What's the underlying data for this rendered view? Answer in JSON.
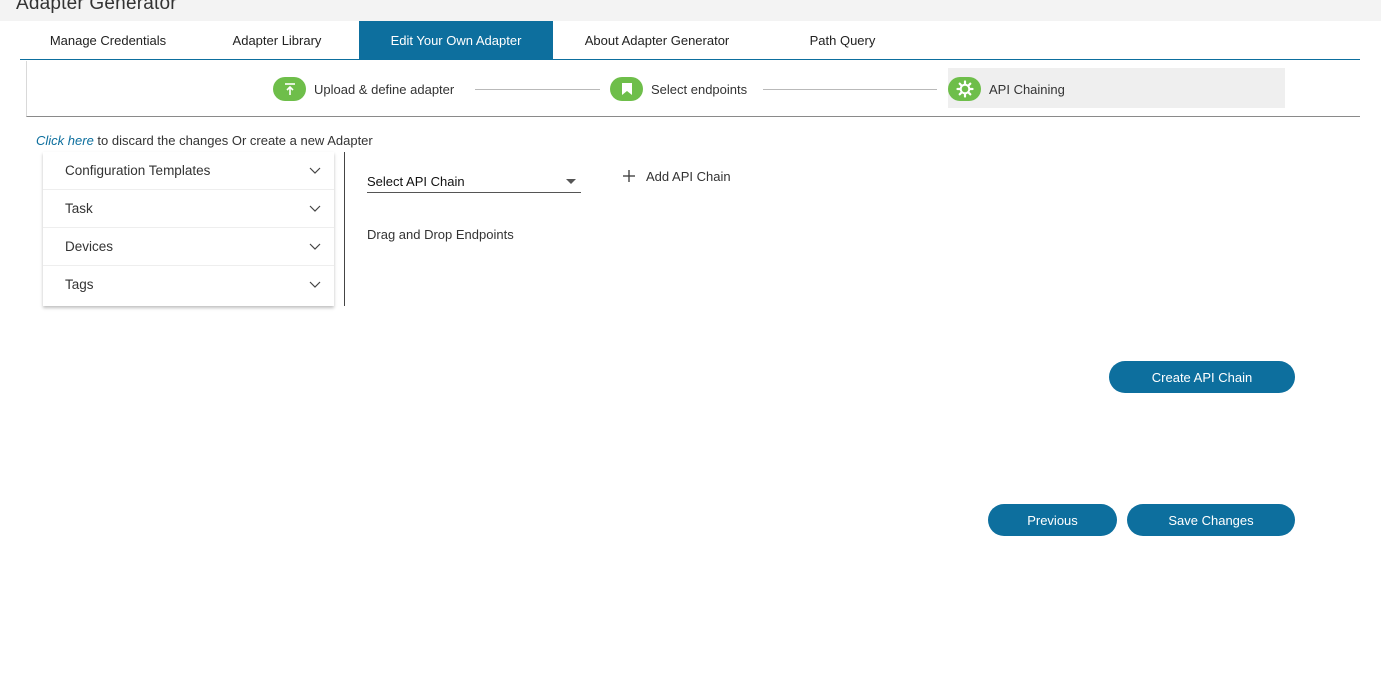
{
  "app": {
    "title": "Adapter Generator"
  },
  "tabs": [
    {
      "label": "Manage Credentials"
    },
    {
      "label": "Adapter Library"
    },
    {
      "label": "Edit Your Own Adapter",
      "active": true
    },
    {
      "label": "About Adapter Generator"
    },
    {
      "label": "Path Query"
    }
  ],
  "stepper": {
    "steps": [
      {
        "label": "Upload & define adapter",
        "icon": "upload-icon"
      },
      {
        "label": "Select endpoints",
        "icon": "bookmark-icon"
      },
      {
        "label": "API Chaining",
        "icon": "gear-icon",
        "active": true
      }
    ]
  },
  "discard": {
    "link_text": "Click here",
    "rest_text": " to discard the changes Or create a new Adapter"
  },
  "accordion": {
    "items": [
      {
        "label": "Configuration Templates"
      },
      {
        "label": "Task"
      },
      {
        "label": "Devices"
      },
      {
        "label": "Tags"
      }
    ]
  },
  "chain": {
    "select_value": "Select API Chain",
    "add_label": "Add API Chain",
    "dnd_text": "Drag and Drop Endpoints",
    "create_label": "Create API Chain"
  },
  "footer": {
    "previous_label": "Previous",
    "save_label": "Save Changes"
  },
  "colors": {
    "primary": "#0d6f9e",
    "step_green": "#6ebe4a"
  }
}
